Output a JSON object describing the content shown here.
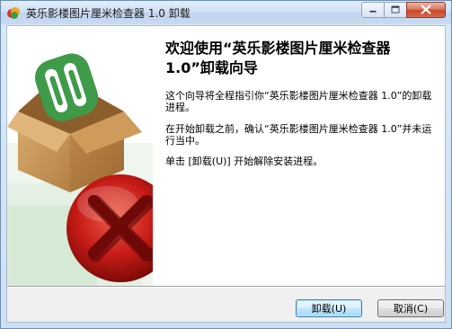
{
  "window": {
    "title": "英乐影楼图片厘米检查器 1.0 卸载",
    "controls": {
      "minimize": "minimize",
      "maximize": "maximize",
      "close": "close"
    }
  },
  "wizard": {
    "heading": "欢迎使用“英乐影楼图片厘米检查器 1.0”卸载向导",
    "paragraph1": "这个向导将全程指引你“英乐影楼图片厘米检查器 1.0”的卸载进程。",
    "paragraph2": "在开始卸载之前，确认“英乐影楼图片厘米检查器 1.0”并未运行当中。",
    "paragraph3": "单击 [卸载(U)] 开始解除安装进程。"
  },
  "buttons": {
    "uninstall": "卸载(U)",
    "cancel": "取消(C)"
  },
  "colors": {
    "title_bar": "#cfe0f4",
    "close_button": "#c8462b",
    "box": "#c99a5b",
    "logo_green": "#3f9a4a",
    "error_red": "#c41a16"
  },
  "icons": {
    "app": "app-icon",
    "box": "package-box-icon",
    "error": "error-x-icon"
  }
}
